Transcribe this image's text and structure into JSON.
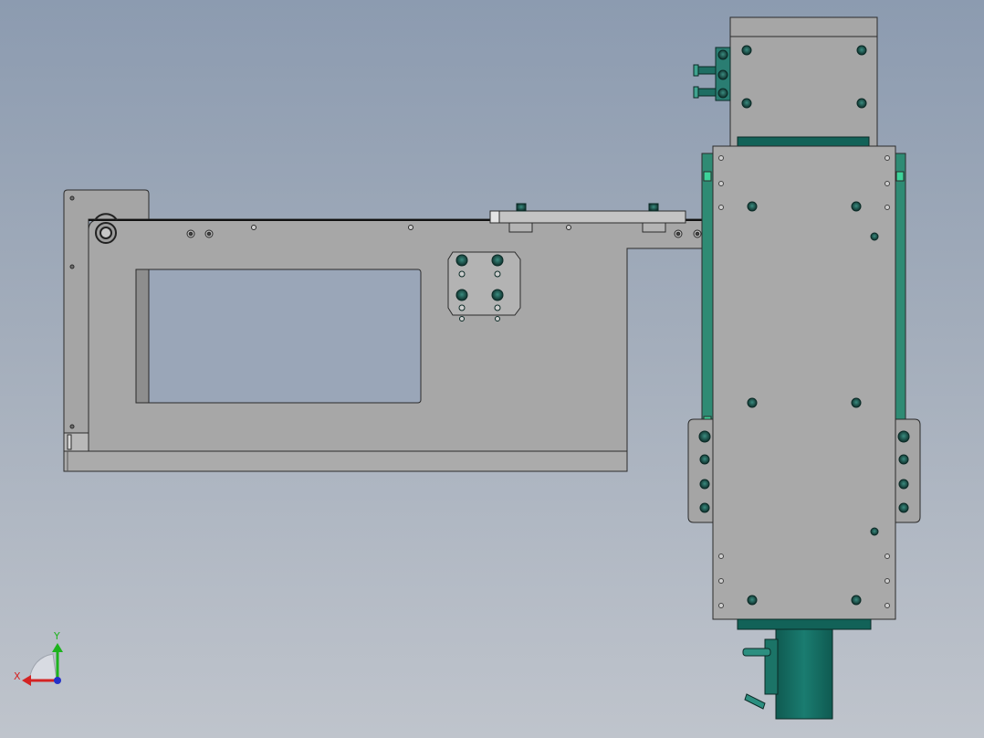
{
  "view": {
    "background_top": "#8c9bb0",
    "background_bottom": "#bfc4cc",
    "plate_color": "#a7a7a7",
    "edge_color": "#2b2b2b",
    "motor_color": "#156e63",
    "accent_green": "#2fb88a"
  },
  "triad": {
    "x_label": "X",
    "y_label": "Y",
    "x_color": "#d42323",
    "y_color": "#1db31d",
    "z_color": "#2431c9"
  }
}
